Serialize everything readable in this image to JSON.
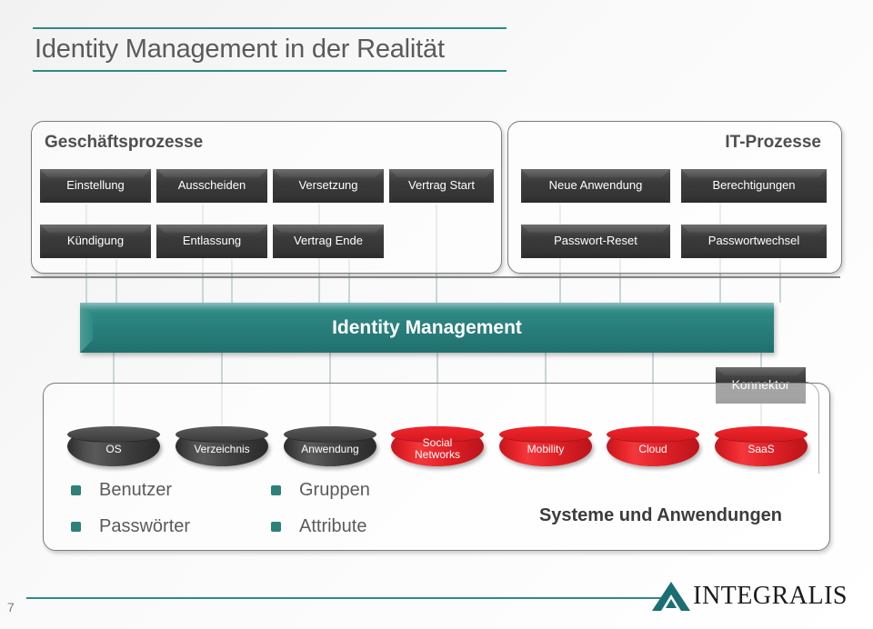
{
  "slide": {
    "title": "Identity Management in der Realität",
    "page_number": "7",
    "accent_color": "#2e8b86",
    "box_color": "#3a3a3a",
    "highlight_color": "#e02026"
  },
  "business_panel": {
    "heading": "Geschäftsprozesse",
    "row1": [
      "Einstellung",
      "Ausscheiden",
      "Versetzung",
      "Vertrag Start"
    ],
    "row2": [
      "Kündigung",
      "Entlassung",
      "Vertrag Ende"
    ]
  },
  "it_panel": {
    "heading": "IT-Prozesse",
    "row1": [
      "Neue Anwendung",
      "Berechtigungen"
    ],
    "row2": [
      "Passwort-Reset",
      "Passwortwechsel"
    ]
  },
  "identity_bar": {
    "label": "Identity Management"
  },
  "connector": {
    "label": "Konnektor"
  },
  "systems_panel": {
    "caption": "Systeme und Anwendungen",
    "cylinders": [
      {
        "label": "OS",
        "color": "dark"
      },
      {
        "label": "Verzeichnis",
        "color": "dark"
      },
      {
        "label": "Anwendung",
        "color": "dark"
      },
      {
        "label": "Social\nNetworks",
        "color": "red"
      },
      {
        "label": "Mobility",
        "color": "red"
      },
      {
        "label": "Cloud",
        "color": "red"
      },
      {
        "label": "SaaS",
        "color": "red"
      }
    ],
    "legend": [
      {
        "label": "Benutzer",
        "column": 1,
        "row": 1
      },
      {
        "label": "Passwörter",
        "column": 1,
        "row": 2
      },
      {
        "label": "Gruppen",
        "column": 2,
        "row": 1
      },
      {
        "label": "Attribute",
        "column": 2,
        "row": 2
      }
    ]
  },
  "footer": {
    "logo_text": "INTEGRALIS",
    "logo_mark": "triangle-icon"
  }
}
